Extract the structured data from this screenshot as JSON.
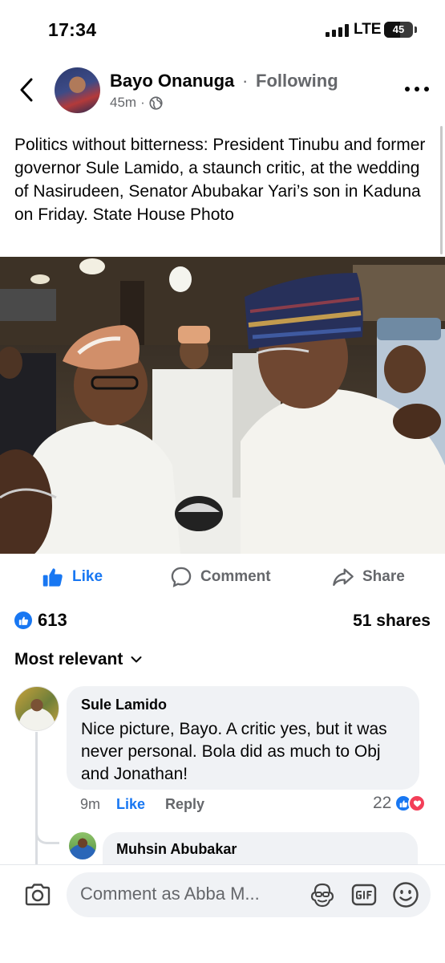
{
  "status_bar": {
    "time": "17:34",
    "network": "LTE",
    "battery": "45"
  },
  "post": {
    "author": "Bayo Onanuga",
    "separator": "·",
    "follow_status": "Following",
    "time_ago": "45m",
    "meta_separator": "·",
    "privacy_icon": "globe-icon",
    "caption": "Politics without bitterness: President Tinubu and former governor Sule Lamido, a staunch critic, at the wedding of Nasirudeen, Senator Abubakar Yari’s son in Kaduna on Friday. State House Photo",
    "actions": {
      "like": "Like",
      "comment": "Comment",
      "share": "Share"
    },
    "reaction_count": "613",
    "shares": "51 shares",
    "sort_label": "Most relevant"
  },
  "comments": [
    {
      "author": "Sule Lamido",
      "text": "Nice picture, Bayo. A critic yes, but it was never personal. Bola did as much to Obj and Jonathan!",
      "time": "9m",
      "like_label": "Like",
      "reply_label": "Reply",
      "reaction_count": "22"
    },
    {
      "author": "Muhsin Abubakar"
    }
  ],
  "composer": {
    "placeholder": "Comment as Abba M..."
  },
  "colors": {
    "accent": "#1877f2",
    "muted": "#65676b",
    "bubble": "#f0f2f5",
    "love": "#f33e58"
  }
}
